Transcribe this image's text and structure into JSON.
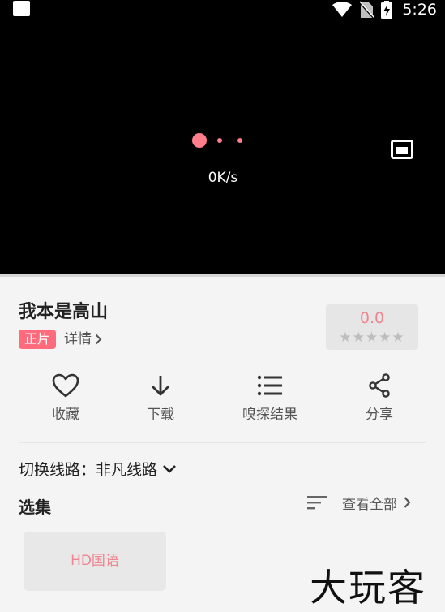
{
  "status_bar": {
    "time": "5:26"
  },
  "player": {
    "speed": "0K/s",
    "accent_color": "#ff7e8b"
  },
  "video": {
    "title": "我本是高山",
    "badge": "正片",
    "detail_label": "详情",
    "rating": {
      "score": "0.0",
      "stars_filled": 0,
      "stars_total": 5,
      "stars": "★★★★★"
    }
  },
  "actions": [
    {
      "label": "收藏",
      "icon": "heart-icon"
    },
    {
      "label": "下载",
      "icon": "download-arrow-icon"
    },
    {
      "label": "嗅探结果",
      "icon": "list-icon"
    },
    {
      "label": "分享",
      "icon": "share-icon"
    }
  ],
  "route": {
    "label": "切换线路：非凡线路"
  },
  "episodes": {
    "title": "选集",
    "view_all": "查看全部",
    "items": [
      {
        "label": "HD国语"
      }
    ]
  },
  "watermark": "大玩客",
  "colors": {
    "accent": "#ff6b7d",
    "rating": "#f0848f",
    "background": "#f4f4f4"
  }
}
